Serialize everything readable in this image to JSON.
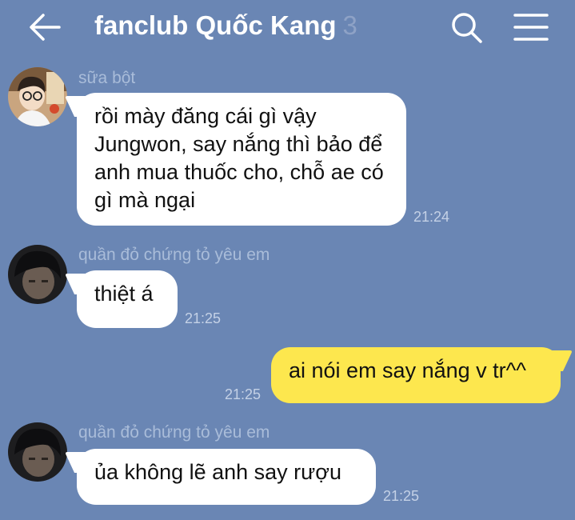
{
  "header": {
    "back_icon": "arrow-left-icon",
    "title": "fanclub Quốc Kang",
    "member_count": "3",
    "search_icon": "search-icon",
    "menu_icon": "hamburger-menu-icon"
  },
  "colors": {
    "background": "#6a86b4",
    "incoming_bubble": "#ffffff",
    "outgoing_bubble": "#fde74e"
  },
  "messages": [
    {
      "sender": "sữa bột",
      "text": "rồi mày đăng cái gì vậy Jungwon, say nắng thì bảo để anh mua thuốc cho, chỗ ae có gì mà ngại",
      "time": "21:24",
      "direction": "incoming"
    },
    {
      "sender": "quần đỏ chứng tỏ yêu em",
      "text": "thiệt á",
      "time": "21:25",
      "direction": "incoming"
    },
    {
      "text": "ai nói em say nắng v tr^^",
      "time": "21:25",
      "direction": "outgoing"
    },
    {
      "sender": "quần đỏ chứng tỏ yêu em",
      "text": "ủa không lẽ anh say rượu",
      "time": "21:25",
      "direction": "incoming"
    }
  ]
}
